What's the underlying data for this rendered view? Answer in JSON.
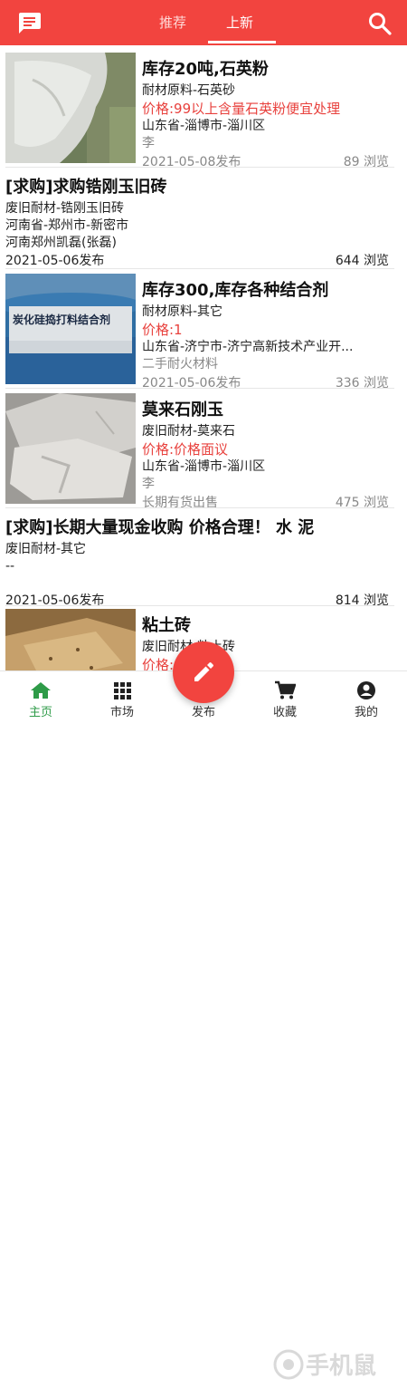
{
  "header": {
    "tabs": [
      {
        "label": "推荐"
      },
      {
        "label": "上新"
      }
    ],
    "active_tab": "上新"
  },
  "items": [
    {
      "title": "库存20吨,石英粉",
      "category": "耐材原料-石英砂",
      "price": "价格:99以上含量石英粉便宜处理",
      "location": "山东省-淄博市-淄川区",
      "seller": "李",
      "date": "2021-05-08发布",
      "views": "89 浏览"
    },
    {
      "title": "[求购]求购锆刚玉旧砖",
      "category": "废旧耐材-锆刚玉旧砖",
      "location": "河南省-郑州市-新密市",
      "seller": "河南郑州凯磊(张磊)",
      "date": "2021-05-06发布",
      "views": "644 浏览"
    },
    {
      "title": "库存300,库存各种结合剂",
      "category": "耐材原料-其它",
      "price": "价格:1",
      "location": "山东省-济宁市-济宁高新技术产业开...",
      "seller": "二手耐火材料",
      "date": "2021-05-06发布",
      "views": "336 浏览",
      "image_text": "炭化硅捣打料结合剂"
    },
    {
      "title": "莫来石刚玉",
      "category": "废旧耐材-莫来石",
      "price": "价格:价格面议",
      "location": "山东省-淄博市-淄川区",
      "seller": "李",
      "date": "长期有货出售",
      "views": "475 浏览"
    },
    {
      "title": "[求购]长期大量现金收购 价格合理！ 水 泥",
      "category": "废旧耐材-其它",
      "seller": "--",
      "date": "2021-05-06发布",
      "views": "814 浏览"
    },
    {
      "title": "粘土砖",
      "category": "废旧耐材-粘土砖",
      "price": "价格:价格面议"
    }
  ],
  "bottom_nav": [
    {
      "label": "主页",
      "icon": "home-icon"
    },
    {
      "label": "市场",
      "icon": "grid-icon"
    },
    {
      "label": "发布",
      "icon": "pencil-icon"
    },
    {
      "label": "收藏",
      "icon": "cart-icon"
    },
    {
      "label": "我的",
      "icon": "person-icon"
    }
  ],
  "active_nav": "主页",
  "watermark": "手机鼠",
  "colors": {
    "accent": "#f2443f",
    "price": "#e8413d",
    "nav_active": "#2e9b48"
  }
}
